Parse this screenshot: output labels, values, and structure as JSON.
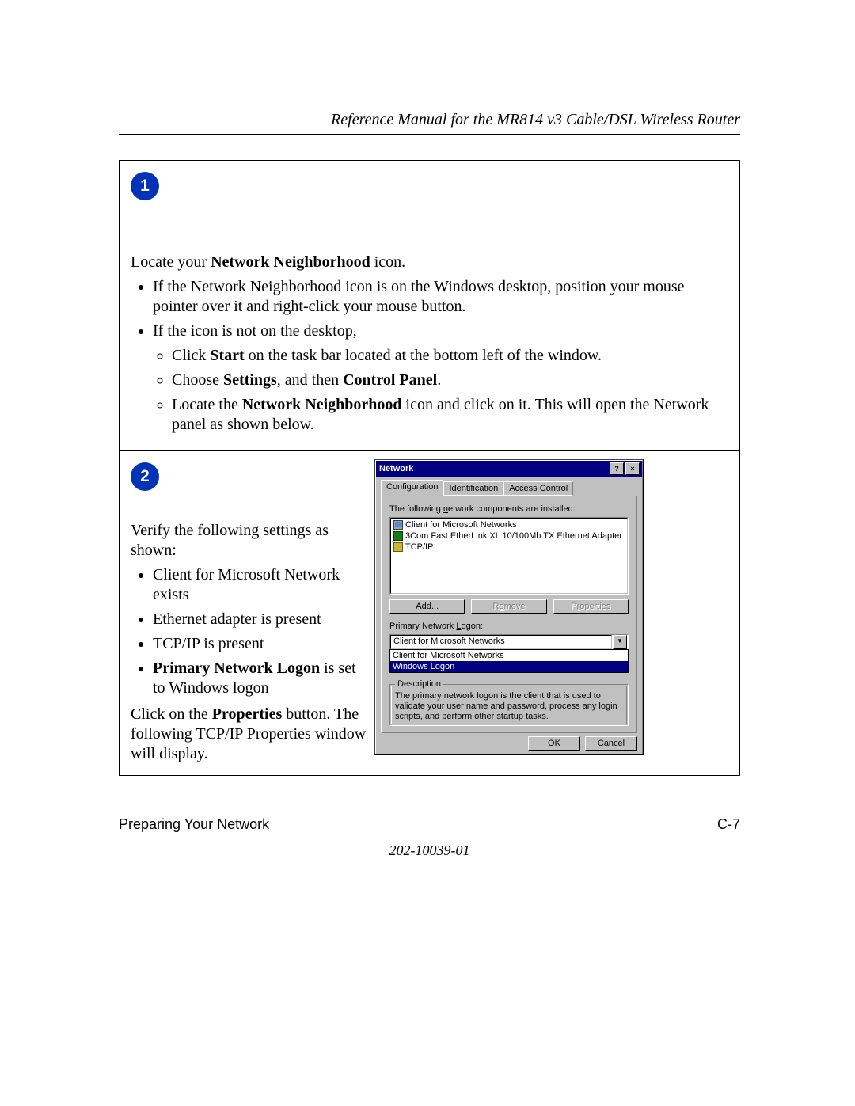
{
  "header_title": "Reference Manual for the MR814 v3 Cable/DSL Wireless Router",
  "step1": {
    "badge": "1",
    "intro_prefix": "Locate your ",
    "intro_bold": "Network Neighborhood",
    "intro_suffix": " icon.",
    "b1": "If the Network Neighborhood icon is on the Windows desktop, position your mouse pointer over it and right-click your mouse button.",
    "b2": "If the icon is not on the desktop,",
    "b2a_pre": "Click ",
    "b2a_bold": "Start",
    "b2a_post": " on the task bar located at the bottom left of the window.",
    "b2b_pre": "Choose ",
    "b2b_bold1": "Settings",
    "b2b_mid": ", and then ",
    "b2b_bold2": "Control Panel",
    "b2b_post": ".",
    "b2c_pre": "Locate the ",
    "b2c_bold": "Network Neighborhood",
    "b2c_post": " icon and click on it. This will open the Network panel as shown below."
  },
  "step2": {
    "badge": "2",
    "verify_intro": "Verify the following settings as shown:",
    "v1": "Client for Microsoft Network exists",
    "v2": "Ethernet adapter is present",
    "v3": "TCP/IP is present",
    "v4bold": "Primary Network Logon",
    "v4rest": " is set to Windows logon",
    "click_pre": "Click on the ",
    "click_bold": "Properties",
    "click_post": " button. The following TCP/IP Properties window will display."
  },
  "dlg": {
    "title": "Network",
    "help_btn": "?",
    "close_btn": "×",
    "tabs": {
      "t1": "Configuration",
      "t2": "Identification",
      "t3": "Access Control"
    },
    "components_label_pre": "The following ",
    "components_label_u": "n",
    "components_label_post": "etwork components are installed:",
    "comp1": "Client for Microsoft Networks",
    "comp2": "3Com Fast EtherLink XL 10/100Mb TX Ethernet Adapter",
    "comp3": "TCP/IP",
    "btn_add_u": "A",
    "btn_add_rest": "dd...",
    "btn_remove_pre": "R",
    "btn_remove_u": "e",
    "btn_remove_post": "move",
    "btn_prop_pre": "P",
    "btn_prop_u": "r",
    "btn_prop_post": "operties",
    "pnl_label_pre": "Primary Network ",
    "pnl_label_u": "L",
    "pnl_label_post": "ogon:",
    "selected_logon": "Client for Microsoft Networks",
    "drop_opt1": "Client for Microsoft Networks",
    "drop_opt2": "Windows Logon",
    "desc_legend": "Description",
    "desc_text": "The primary network logon is the client that is used to validate your user name and password, process any login scripts, and perform other startup tasks.",
    "ok": "OK",
    "cancel": "Cancel"
  },
  "footer": {
    "left": "Preparing Your Network",
    "right": "C-7",
    "docnum": "202-10039-01"
  }
}
